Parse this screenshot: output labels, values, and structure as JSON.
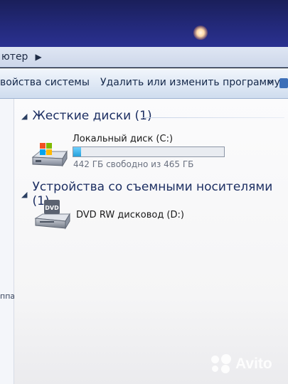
{
  "address_bar": {
    "crumb": "ютер"
  },
  "toolbar": {
    "system_properties": "войства системы",
    "uninstall_program": "Удалить или изменить программу",
    "more": "»"
  },
  "nav_pane": {
    "partial_text": "ппа"
  },
  "groups": {
    "hard_drives": {
      "title": "Жесткие диски (1)",
      "drive": {
        "name": "Локальный диск (C:)",
        "free_text": "442 ГБ свободно из 465 ГБ",
        "used_fraction": 0.05
      }
    },
    "removable": {
      "title": "Устройства со съемными носителями (1)",
      "drive": {
        "name": "DVD RW дисковод (D:)",
        "icon_label": "DVD"
      }
    }
  },
  "watermark": {
    "text": "Avito"
  },
  "colors": {
    "progress": "#26a0da",
    "group_title": "#1d2f63",
    "toolbar_bg": "#dde7f4"
  }
}
